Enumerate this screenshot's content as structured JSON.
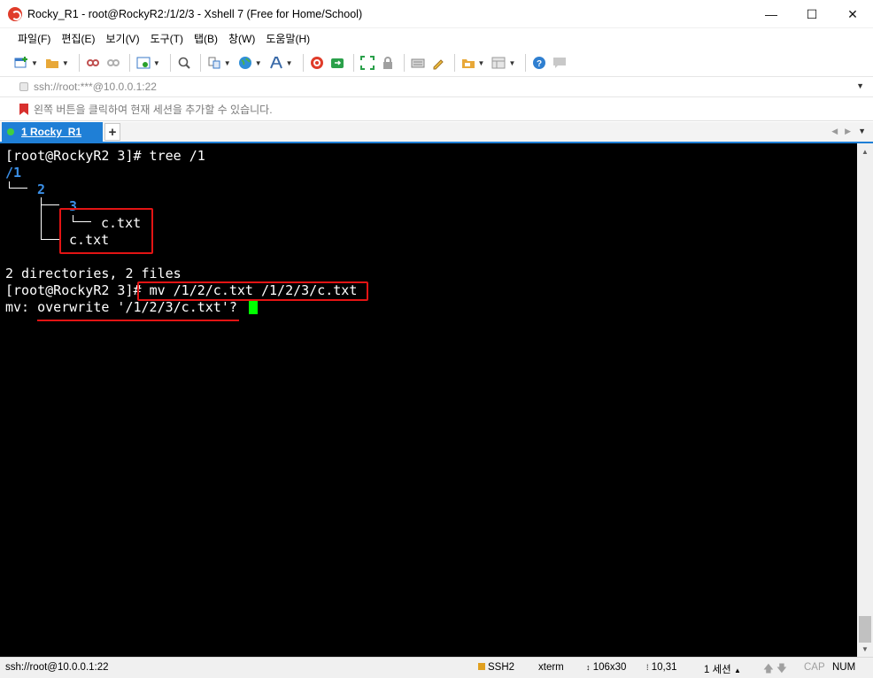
{
  "window": {
    "title": "Rocky_R1 - root@RockyR2:/1/2/3 - Xshell 7 (Free for Home/School)",
    "minimize": "—",
    "maximize": "☐",
    "close": "✕"
  },
  "menu": [
    "파일(F)",
    "편집(E)",
    "보기(V)",
    "도구(T)",
    "탭(B)",
    "창(W)",
    "도움말(H)"
  ],
  "toolbar": {
    "icons": [
      "new-session",
      "open-folder",
      "disconnect",
      "reconnect",
      "session-properties",
      "search",
      "transfer",
      "globe",
      "font",
      "xshell",
      "xftp",
      "fullscreen",
      "lock",
      "keyboard",
      "highlighter",
      "script",
      "layout",
      "help",
      "chat"
    ]
  },
  "address": {
    "url": "ssh://root:***@10.0.0.1:22"
  },
  "hint": {
    "text": "왼쪽 버튼을 클릭하여 현재 세션을 추가할 수 있습니다."
  },
  "tabs": [
    {
      "label": "1 Rocky_R1",
      "active": true
    }
  ],
  "tab_add": "+",
  "terminal": {
    "line1": "[root@RockyR2 3]# tree /1",
    "line2": "/1",
    "line3_dir": "2",
    "line4_dir": "3",
    "line5_file": "c.txt",
    "line6_file": "c.txt",
    "line8": "2 directories, 2 files",
    "line9_prompt": "[root@RockyR2 3]# ",
    "line9_cmd": "mv /1/2/c.txt /1/2/3/c.txt",
    "line10": "mv: overwrite '/1/2/3/c.txt'? "
  },
  "status": {
    "connection": "ssh://root@10.0.0.1:22",
    "protocol": "SSH2",
    "terminal_type": "xterm",
    "size": "106x30",
    "cursor_pos": "10,31",
    "sessions": "1 세션",
    "cap": "CAP",
    "num": "NUM"
  },
  "colors": {
    "tab_active": "#1f7fd6",
    "annotation": "#e31414",
    "dir_text": "#3b8fe6",
    "cursor": "#00ff00"
  }
}
